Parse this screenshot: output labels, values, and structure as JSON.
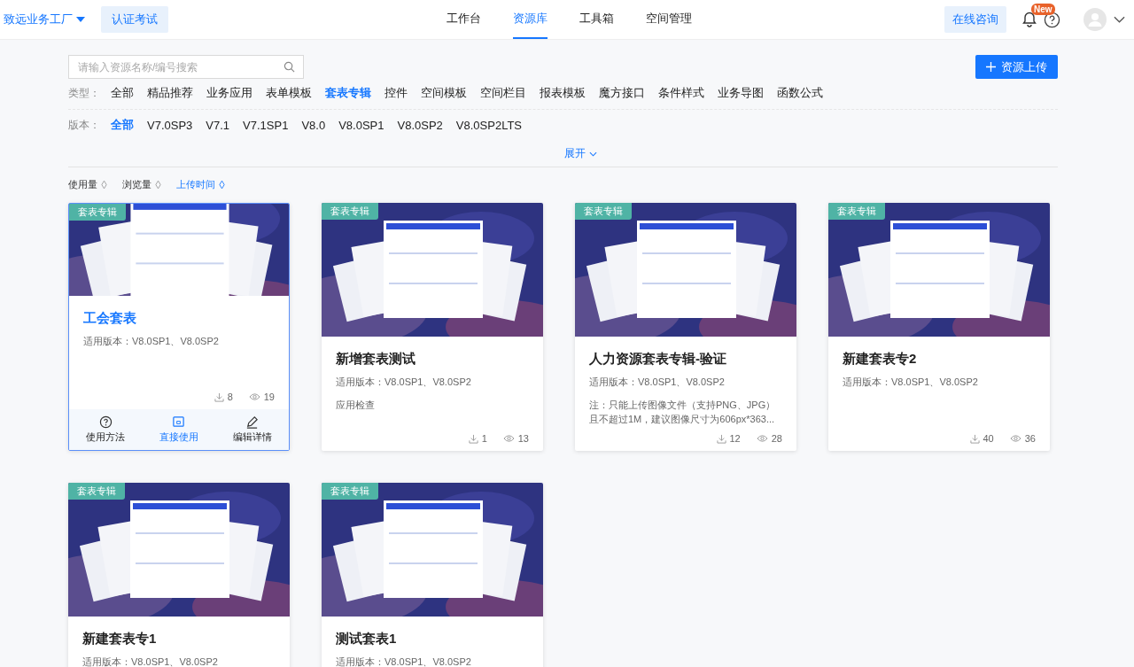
{
  "header": {
    "org": "致远业务工厂",
    "cert_button": "认证考试",
    "nav": [
      {
        "label": "工作台",
        "selected": false
      },
      {
        "label": "资源库",
        "selected": true
      },
      {
        "label": "工具箱",
        "selected": false
      },
      {
        "label": "空间管理",
        "selected": false
      }
    ],
    "consult_button": "在线咨询",
    "badge": "New"
  },
  "search": {
    "placeholder": "请输入资源名称/编号搜索"
  },
  "upload_button": "资源上传",
  "type_filter": {
    "label": "类型：",
    "options": [
      {
        "label": "全部",
        "selected": false
      },
      {
        "label": "精品推荐",
        "selected": false
      },
      {
        "label": "业务应用",
        "selected": false
      },
      {
        "label": "表单模板",
        "selected": false
      },
      {
        "label": "套表专辑",
        "selected": true
      },
      {
        "label": "控件",
        "selected": false
      },
      {
        "label": "空间模板",
        "selected": false
      },
      {
        "label": "空间栏目",
        "selected": false
      },
      {
        "label": "报表模板",
        "selected": false
      },
      {
        "label": "魔方接口",
        "selected": false
      },
      {
        "label": "条件样式",
        "selected": false
      },
      {
        "label": "业务导图",
        "selected": false
      },
      {
        "label": "函数公式",
        "selected": false
      }
    ]
  },
  "version_filter": {
    "label": "版本：",
    "options": [
      {
        "label": "全部",
        "selected": true
      },
      {
        "label": "V7.0SP3",
        "selected": false
      },
      {
        "label": "V7.1",
        "selected": false
      },
      {
        "label": "V7.1SP1",
        "selected": false
      },
      {
        "label": "V8.0",
        "selected": false
      },
      {
        "label": "V8.0SP1",
        "selected": false
      },
      {
        "label": "V8.0SP2",
        "selected": false
      },
      {
        "label": "V8.0SP2LTS",
        "selected": false
      }
    ]
  },
  "expand": "展开",
  "sort": [
    {
      "label": "使用量",
      "selected": false
    },
    {
      "label": "浏览量",
      "selected": false
    },
    {
      "label": "上传时间",
      "selected": true
    }
  ],
  "cards": [
    {
      "tag": "套表专辑",
      "title": "工会套表",
      "versions": "适用版本：V8.0SP1、V8.0SP2",
      "downloads": "8",
      "views": "19",
      "hovered": true,
      "actions": [
        {
          "label": "使用方法",
          "kind": "help"
        },
        {
          "label": "直接使用",
          "kind": "use"
        },
        {
          "label": "编辑详情",
          "kind": "edit"
        }
      ]
    },
    {
      "tag": "套表专辑",
      "title": "新增套表测试",
      "versions": "适用版本：V8.0SP1、V8.0SP2",
      "description": "应用检查",
      "downloads": "1",
      "views": "13",
      "hovered": false
    },
    {
      "tag": "套表专辑",
      "title": "人力资源套表专辑-验证",
      "versions": "适用版本：V8.0SP1、V8.0SP2",
      "description": "注：只能上传图像文件（支持PNG、JPG）且不超过1M，建议图像尺寸为606px*363...",
      "downloads": "12",
      "views": "28",
      "hovered": false
    },
    {
      "tag": "套表专辑",
      "title": "新建套表专2",
      "versions": "适用版本：V8.0SP1、V8.0SP2",
      "downloads": "40",
      "views": "36",
      "hovered": false
    },
    {
      "tag": "套表专辑",
      "title": "新建套表专1",
      "versions": "适用版本：V8.0SP1、V8.0SP2",
      "hovered": false
    },
    {
      "tag": "套表专辑",
      "title": "测试套表1",
      "versions": "适用版本：V8.0SP1、V8.0SP2",
      "hovered": false
    }
  ]
}
